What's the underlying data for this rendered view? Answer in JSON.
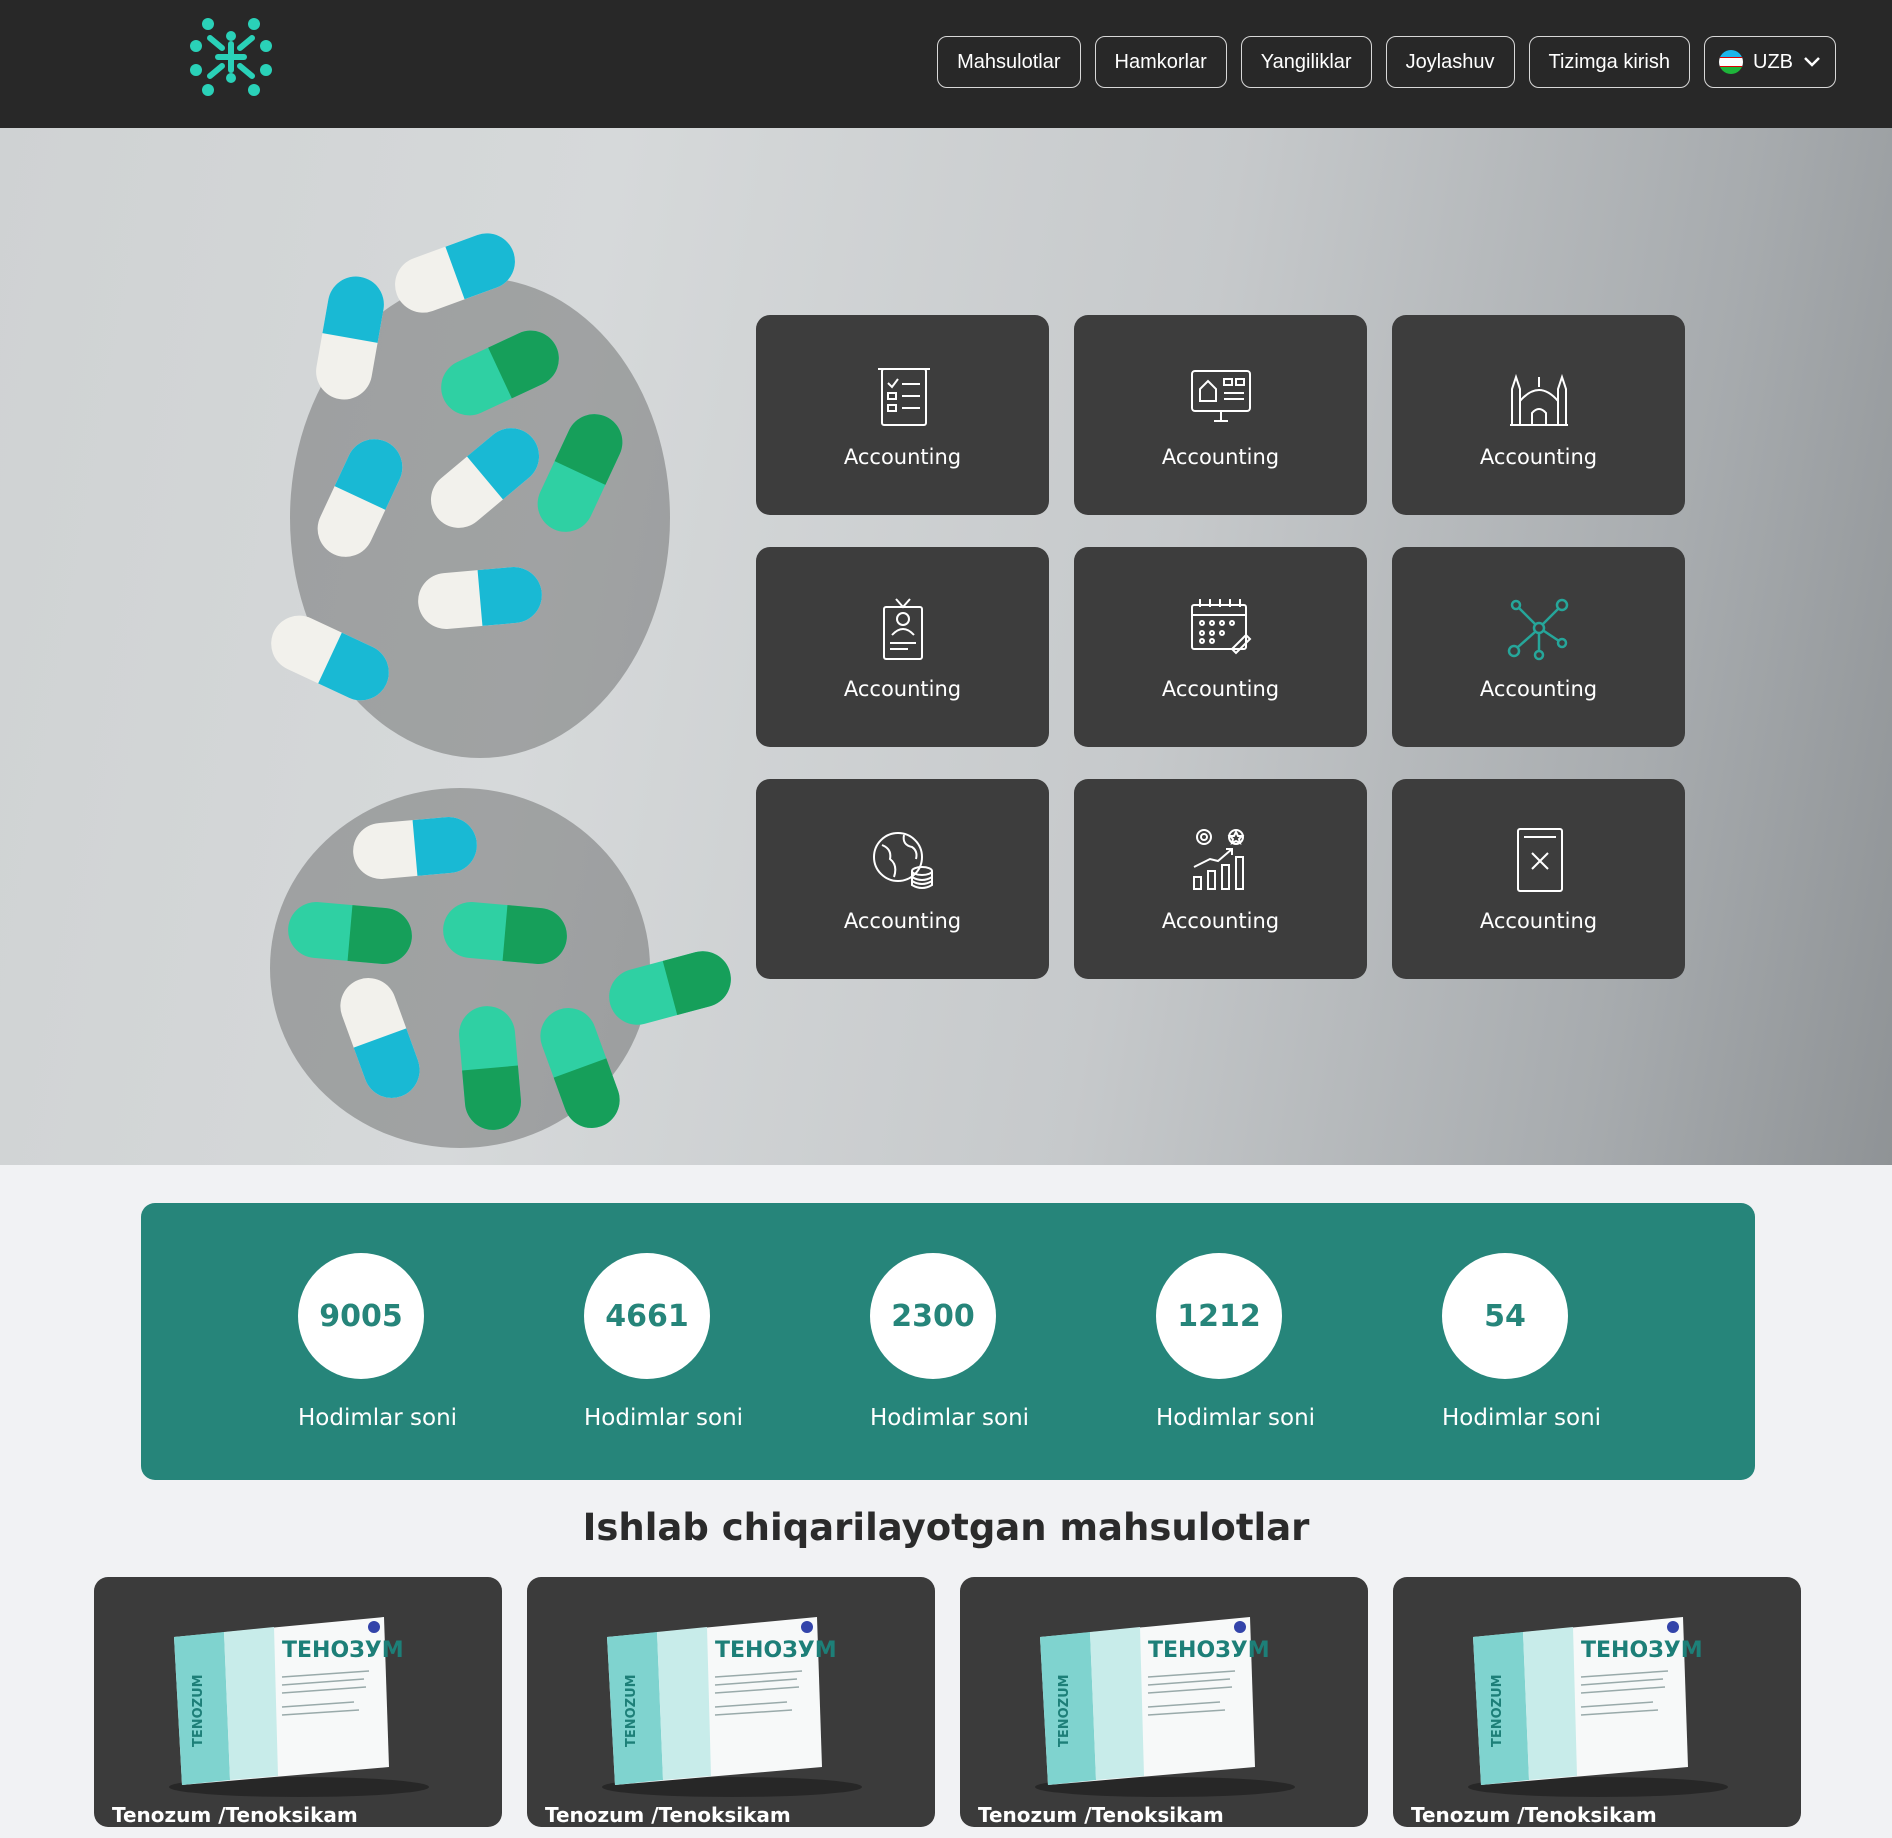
{
  "colors": {
    "header_bg": "#282828",
    "accent": "#26857a",
    "logo": "#2ad1b8",
    "tile_bg": "#3d3d3d"
  },
  "nav": {
    "items": [
      {
        "label": "Mahsulotlar"
      },
      {
        "label": "Hamkorlar"
      },
      {
        "label": "Yangiliklar"
      },
      {
        "label": "Joylashuv"
      },
      {
        "label": "Tizimga kirish"
      }
    ],
    "language": "UZB"
  },
  "tiles": [
    {
      "label": "Accounting",
      "icon": "checklist-document-icon"
    },
    {
      "label": "Accounting",
      "icon": "monitor-dashboard-icon"
    },
    {
      "label": "Accounting",
      "icon": "mosque-icon"
    },
    {
      "label": "Accounting",
      "icon": "id-badge-icon"
    },
    {
      "label": "Accounting",
      "icon": "calendar-icon"
    },
    {
      "label": "Accounting",
      "icon": "network-nodes-icon"
    },
    {
      "label": "Accounting",
      "icon": "globe-coins-icon"
    },
    {
      "label": "Accounting",
      "icon": "growth-chart-gears-icon"
    },
    {
      "label": "Accounting",
      "icon": "document-x-icon"
    }
  ],
  "stats": [
    {
      "value": "9005",
      "label": "Hodimlar soni"
    },
    {
      "value": "4661",
      "label": "Hodimlar soni"
    },
    {
      "value": "2300",
      "label": "Hodimlar soni"
    },
    {
      "value": "1212",
      "label": "Hodimlar soni"
    },
    {
      "value": "54",
      "label": "Hodimlar soni"
    }
  ],
  "products_title": "Ishlab chiqarilayotgan mahsulotlar",
  "products": [
    {
      "name": "Tenozum /Tenoksikam",
      "box_brand": "ТЕНОЗУМ",
      "box_side": "TENOZUM"
    },
    {
      "name": "Tenozum /Tenoksikam",
      "box_brand": "ТЕНОЗУМ",
      "box_side": "TENOZUM"
    },
    {
      "name": "Tenozum /Tenoksikam",
      "box_brand": "ТЕНОЗУМ",
      "box_side": "TENOZUM"
    },
    {
      "name": "Tenozum /Tenoksikam",
      "box_brand": "ТЕНОЗУМ",
      "box_side": "TENOZUM"
    }
  ]
}
